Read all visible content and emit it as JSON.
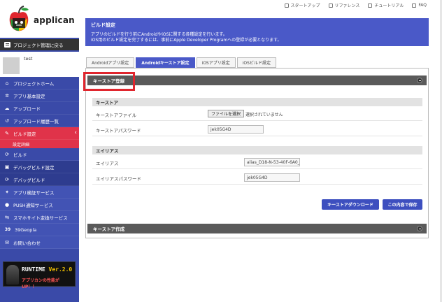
{
  "app": {
    "name": "applican"
  },
  "toplinks": [
    "スタートアップ",
    "リファレンス",
    "チュートリアル",
    "FAQ"
  ],
  "sidebar": {
    "back_label": "プロジェクト管理に戻る",
    "username": "test",
    "items": [
      {
        "label": "プロジェクトホーム",
        "icon": "home-icon"
      },
      {
        "label": "アプリ基本設定",
        "icon": "gear-icon"
      },
      {
        "label": "アップロード",
        "icon": "upload-icon"
      },
      {
        "label": "アップロード履歴一覧",
        "icon": "history-icon"
      },
      {
        "label": "ビルド設定",
        "icon": "wrench-icon"
      },
      {
        "label": "ビルド",
        "icon": "build-icon"
      },
      {
        "label": "デバッグビルド設定",
        "icon": "debug-settings-icon"
      },
      {
        "label": "デバッグビルド",
        "icon": "debug-build-icon"
      },
      {
        "label": "アプリ検証サービス",
        "icon": "tool-icon"
      },
      {
        "label": "PUSH通知サービス",
        "icon": "chat-icon"
      },
      {
        "label": "スマホサイト変換サービス",
        "icon": "convert-icon"
      },
      {
        "label": "39Geopla",
        "icon": "39-icon"
      },
      {
        "label": "お問い合わせ",
        "icon": "mail-icon"
      }
    ],
    "sub_item": "設定詳細",
    "banner": {
      "title_a": "RUNTIME ",
      "title_b": "Ver.2.0",
      "sub": "アプリカンの性能が UP！！"
    }
  },
  "header": {
    "title": "ビルド設定",
    "desc1": "アプリのビルドを行う前にAndroidやiOSに関する各種設定を行います。",
    "desc2": "iOS用のビルド設定を完了するには、事前にApple Developer Programへの登録が必要となります。"
  },
  "tabs": [
    "Androidアプリ設定",
    "Androidキーストア設定",
    "iOSアプリ設定",
    "iOSビルド設定"
  ],
  "panel": {
    "sec1_title": "キーストア登録",
    "keystore": {
      "heading": "キーストア",
      "file_label": "キーストアファイル",
      "file_button": "ファイルを選択",
      "file_status": "選択されていません",
      "password_label": "キーストアパスワード",
      "password_value": "jek05G4D"
    },
    "alias": {
      "heading": "エイリアス",
      "alias_label": "エイリアス",
      "alias_value": "alias_D18-N-53-40F-6A0_",
      "password_label": "エイリアスパスワード",
      "password_value": "jek05G4D"
    },
    "download_button": "キーストアダウンロード",
    "save_button": "この内容で保存",
    "sec2_title": "キーストア作成"
  },
  "colors": {
    "sidebar": "#3a4aa8",
    "active": "#e0334a",
    "header": "#4a59c8",
    "highlight": "#e0262e"
  }
}
